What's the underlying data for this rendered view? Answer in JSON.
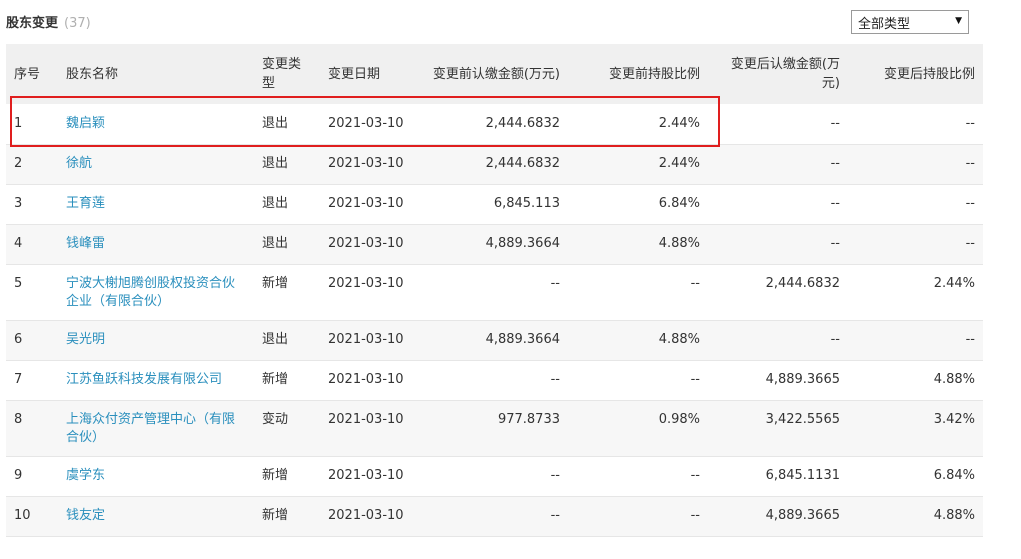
{
  "header": {
    "title": "股东变更",
    "count": "(37)"
  },
  "filter": {
    "selected": "全部类型",
    "arrow": "▼"
  },
  "table": {
    "columns": [
      "序号",
      "股东名称",
      "变更类型",
      "变更日期",
      "变更前认缴金额(万元)",
      "变更前持股比例",
      "变更后认缴金额(万元)",
      "变更后持股比例"
    ],
    "rows": [
      [
        "1",
        "魏启颖",
        "退出",
        "2021-03-10",
        "2,444.6832",
        "2.44%",
        "--",
        "--"
      ],
      [
        "2",
        "徐航",
        "退出",
        "2021-03-10",
        "2,444.6832",
        "2.44%",
        "--",
        "--"
      ],
      [
        "3",
        "王育莲",
        "退出",
        "2021-03-10",
        "6,845.113",
        "6.84%",
        "--",
        "--"
      ],
      [
        "4",
        "钱峰雷",
        "退出",
        "2021-03-10",
        "4,889.3664",
        "4.88%",
        "--",
        "--"
      ],
      [
        "5",
        "宁波大榭旭腾创股权投资合伙企业（有限合伙）",
        "新增",
        "2021-03-10",
        "--",
        "--",
        "2,444.6832",
        "2.44%"
      ],
      [
        "6",
        "吴光明",
        "退出",
        "2021-03-10",
        "4,889.3664",
        "4.88%",
        "--",
        "--"
      ],
      [
        "7",
        "江苏鱼跃科技发展有限公司",
        "新增",
        "2021-03-10",
        "--",
        "--",
        "4,889.3665",
        "4.88%"
      ],
      [
        "8",
        "上海众付资产管理中心（有限合伙）",
        "变动",
        "2021-03-10",
        "977.8733",
        "0.98%",
        "3,422.5565",
        "3.42%"
      ],
      [
        "9",
        "虞学东",
        "新增",
        "2021-03-10",
        "--",
        "--",
        "6,845.1131",
        "6.84%"
      ],
      [
        "10",
        "钱友定",
        "新增",
        "2021-03-10",
        "--",
        "--",
        "4,889.3665",
        "4.88%"
      ]
    ]
  }
}
